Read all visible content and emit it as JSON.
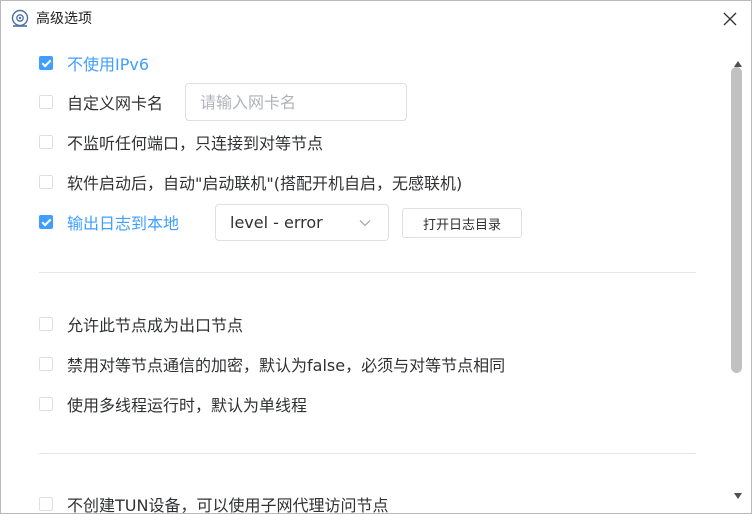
{
  "window": {
    "title": "高级选项"
  },
  "options": {
    "disable_ipv6": {
      "label": "不使用IPv6",
      "checked": true
    },
    "custom_nic": {
      "label": "自定义网卡名",
      "checked": false,
      "placeholder": "请输入网卡名",
      "value": ""
    },
    "no_listen": {
      "label": "不监听任何端口，只连接到对等节点",
      "checked": false
    },
    "autostart": {
      "label": "软件启动后，自动\"启动联机\"(搭配开机自启，无感联机)",
      "checked": false
    },
    "log_local": {
      "label": "输出日志到本地",
      "checked": true,
      "level": "level - error",
      "open_dir_label": "打开日志目录"
    },
    "exit_node": {
      "label": "允许此节点成为出口节点",
      "checked": false
    },
    "disable_encryption": {
      "label": "禁用对等节点通信的加密，默认为false，必须与对等节点相同",
      "checked": false
    },
    "multi_thread": {
      "label": "使用多线程运行时，默认为单线程",
      "checked": false
    },
    "no_tun": {
      "label": "不创建TUN设备，可以使用子网代理访问节点",
      "checked": false
    }
  },
  "icons": {
    "app": "network-app-icon",
    "close": "close-icon",
    "dropdown": "chevron-down-icon"
  },
  "colors": {
    "accent": "#409eff",
    "border": "#dcdfe6",
    "text": "#303133"
  }
}
